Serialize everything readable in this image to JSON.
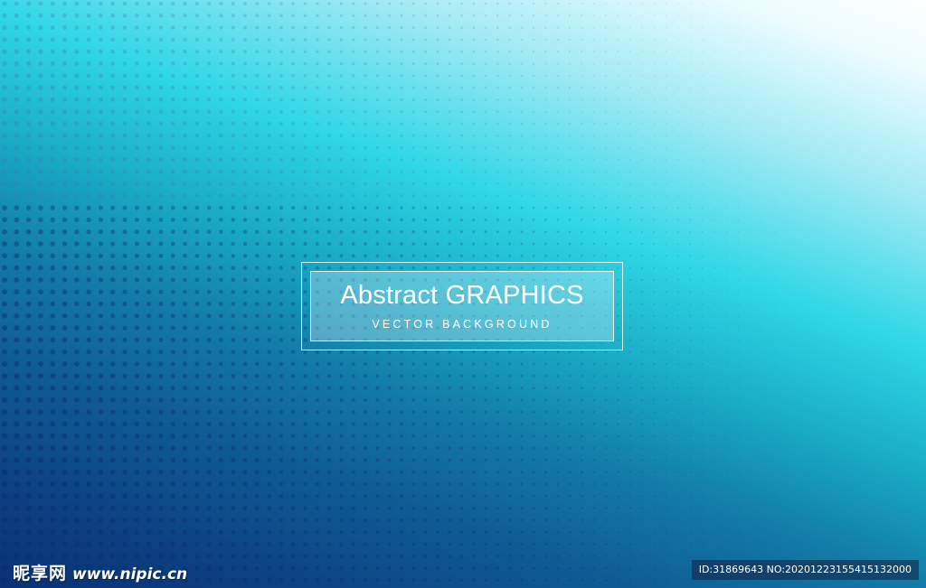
{
  "banner": {
    "title": "Abstract GRAPHICS",
    "subtitle": "VECTOR BACKGROUND"
  },
  "watermark": {
    "logo_text": "昵享网",
    "url": "www.nipic.cn",
    "id_text": "ID:31869643 NO:20201223155415132000"
  },
  "colors": {
    "top_right": "#ffffff",
    "cyan": "#2fd7e6",
    "mid_blue": "#137ca8",
    "deep_blue": "#0a3174",
    "dot_dark": "#0a2f6f"
  }
}
